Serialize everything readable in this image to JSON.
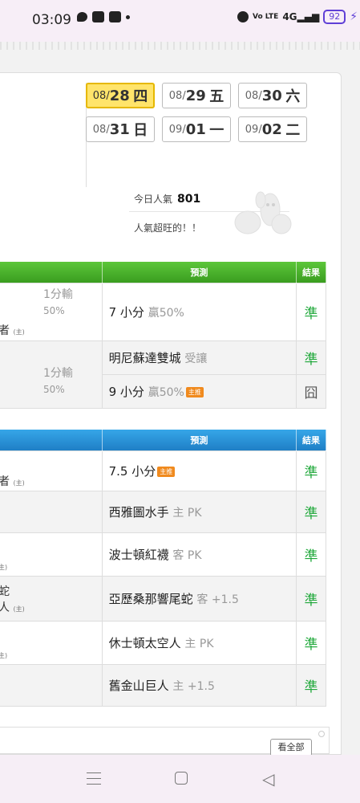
{
  "status_bar": {
    "time": "03:09",
    "volte": "Vo LTE",
    "network": "4G",
    "battery": "92"
  },
  "dates": [
    [
      {
        "md": "08/",
        "day": "28",
        "wd": "四",
        "active": true
      },
      {
        "md": "08/",
        "day": "29",
        "wd": "五"
      },
      {
        "md": "08/",
        "day": "30",
        "wd": "六"
      }
    ],
    [
      {
        "md": "08/",
        "day": "31",
        "wd": "日"
      },
      {
        "md": "09/",
        "day": "01",
        "wd": "一"
      },
      {
        "md": "09/",
        "day": "02",
        "wd": "二"
      }
    ]
  ],
  "popularity": {
    "label": "今日人氣",
    "value": "801",
    "sub": "人氣超旺的！！"
  },
  "table1": {
    "headers": {
      "prediction": "預測",
      "result": "結果"
    },
    "rows": [
      {
        "lost_a": "1分輸",
        "lost_b": "50%",
        "frag": "者",
        "frag_small": "(主)",
        "pred": "7 小分",
        "extra": "贏50%",
        "tag": "",
        "result": "準"
      },
      {
        "pred": "明尼蘇達雙城",
        "extra": "受讓",
        "tag": "",
        "result": "準"
      },
      {
        "lost_a": "1分輸",
        "lost_b": "50%",
        "pred": "9 小分",
        "extra": "贏50%",
        "tag": "主推",
        "result": "囧"
      }
    ]
  },
  "table2": {
    "headers": {
      "prediction": "預測",
      "result": "結果"
    },
    "rows": [
      {
        "frag": "者",
        "frag_small": "(主)",
        "pred": "7.5 小分",
        "extra": "",
        "tag": "主推",
        "result": "準"
      },
      {
        "pred": "西雅圖水手",
        "extra": "主 PK",
        "result": "準"
      },
      {
        "frag": "",
        "frag_small": "主)",
        "pred": "波士頓紅襪",
        "extra": "客 PK",
        "result": "準"
      },
      {
        "frag": "蛇",
        "frag2": "人",
        "frag_small": "(主)",
        "pred": "亞歷桑那響尾蛇",
        "extra": "客 +1.5",
        "result": "準"
      },
      {
        "frag": "",
        "frag_small": "主)",
        "pred": "休士頓太空人",
        "extra": "主 PK",
        "result": "準"
      },
      {
        "pred": "舊金山巨人",
        "extra": "主 +1.5",
        "result": "準"
      }
    ]
  },
  "see_all": "看全部"
}
